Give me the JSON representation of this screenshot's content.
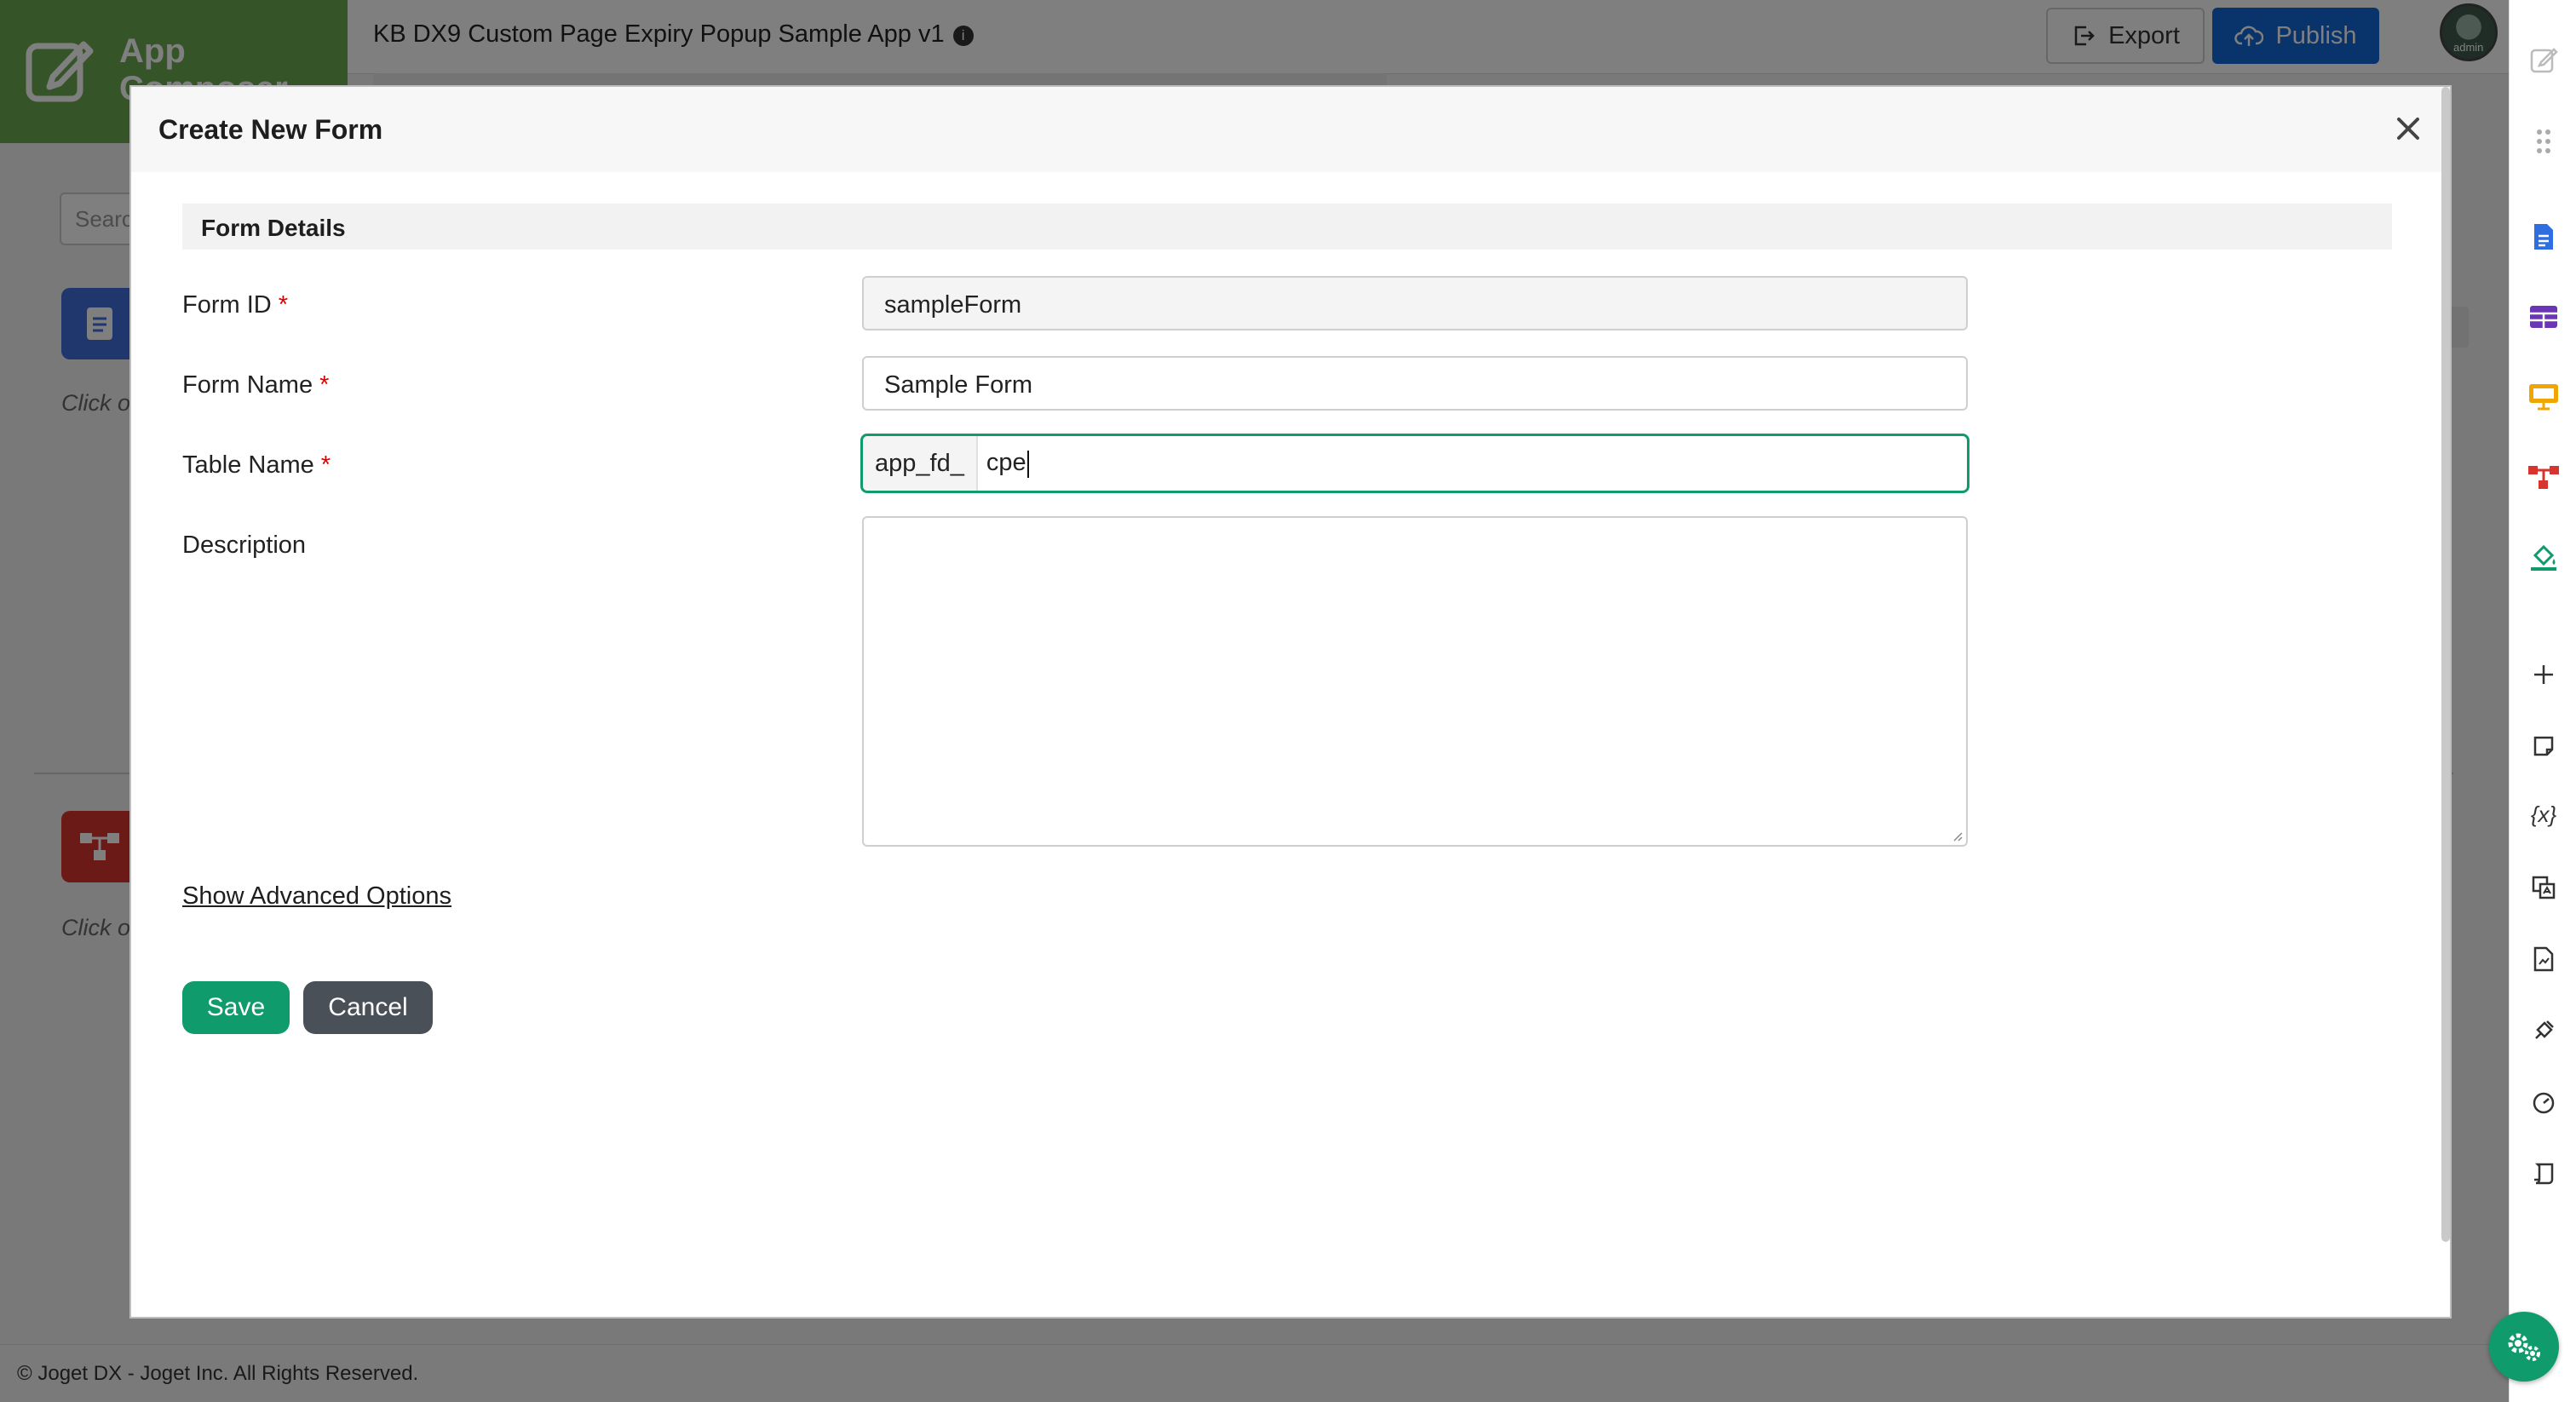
{
  "header": {
    "brand": "App Composer",
    "app_title": "KB DX9 Custom Page Expiry Popup Sample App v1",
    "info_icon": "i",
    "export_label": "Export",
    "publish_label": "Publish",
    "avatar_label": "admin"
  },
  "background": {
    "search_placeholder": "Search",
    "click_hint_1": "Click on...",
    "click_hint_2": "Click on..."
  },
  "footer": {
    "text": "© Joget DX - Joget Inc. All Rights Reserved."
  },
  "modal": {
    "title": "Create New Form",
    "section_title": "Form Details",
    "fields": {
      "form_id": {
        "label": "Form ID",
        "value": "sampleForm",
        "required": "*"
      },
      "form_name": {
        "label": "Form Name",
        "value": "Sample Form",
        "required": "*"
      },
      "table_name": {
        "label": "Table Name",
        "prefix": "app_fd_",
        "value": "cpe",
        "required": "*"
      },
      "description": {
        "label": "Description",
        "value": ""
      }
    },
    "advanced_link": "Show Advanced Options",
    "save_label": "Save",
    "cancel_label": "Cancel"
  },
  "colors": {
    "brand": "#6aa84f",
    "primary": "#1266d6",
    "success": "#0f9b6c",
    "secondary": "#4a5057",
    "required": "#e00000"
  },
  "rail_icons": [
    "edit-icon",
    "drag-handle-icon",
    "form-icon",
    "datalist-icon",
    "userview-icon",
    "process-icon",
    "theme-icon",
    "add-icon",
    "note-icon",
    "variable-icon",
    "translate-icon",
    "report-icon",
    "plugin-icon",
    "performance-icon",
    "log-icon"
  ]
}
